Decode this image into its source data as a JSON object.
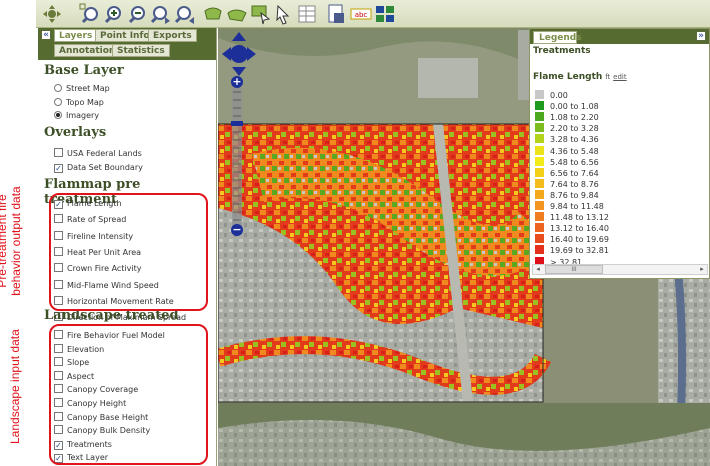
{
  "toolbar": {
    "buttons": [
      {
        "name": "pan-icon"
      },
      {
        "name": "zoom-extent-icon"
      },
      {
        "name": "zoom-in-icon"
      },
      {
        "name": "zoom-out-icon"
      },
      {
        "name": "zoom-previous-icon"
      },
      {
        "name": "zoom-next-icon"
      },
      {
        "name": "draw-polygon-icon"
      },
      {
        "name": "draw-area-icon"
      },
      {
        "name": "draw-select-icon"
      },
      {
        "name": "identify-icon"
      },
      {
        "name": "table-icon"
      },
      {
        "name": "export-icon"
      },
      {
        "name": "label-icon"
      },
      {
        "name": "layers-icon"
      }
    ],
    "label_icon_text": "abc"
  },
  "annotations": {
    "pre_treatment": [
      "Pre-treatment fire",
      "behavior output data"
    ],
    "landscape_input": "Landscape input data"
  },
  "left_panel": {
    "collapse_glyph": "«",
    "tabs": [
      "Layers",
      "Point Info",
      "Exports",
      "Annotation",
      "Statistics"
    ],
    "base_layer": {
      "title": "Base Layer",
      "options": [
        {
          "label": "Street Map",
          "selected": false
        },
        {
          "label": "Topo Map",
          "selected": false
        },
        {
          "label": "Imagery",
          "selected": true
        }
      ]
    },
    "overlays": {
      "title": "Overlays",
      "items": [
        {
          "label": "USA Federal Lands",
          "checked": false
        },
        {
          "label": "Data Set Boundary",
          "checked": true
        }
      ]
    },
    "flammap": {
      "title": "Flammap pre treatment",
      "items": [
        {
          "label": "Flame Length",
          "checked": true
        },
        {
          "label": "Rate of Spread",
          "checked": false
        },
        {
          "label": "Fireline Intensity",
          "checked": false
        },
        {
          "label": "Heat Per Unit Area",
          "checked": false
        },
        {
          "label": "Crown Fire Activity",
          "checked": false
        },
        {
          "label": "Mid-Flame Wind Speed",
          "checked": false
        },
        {
          "label": "Horizontal Movement Rate",
          "checked": false
        },
        {
          "label": "Direction of Maximum Spread",
          "checked": false
        }
      ]
    },
    "landscape": {
      "title": "Landscape treated",
      "items": [
        {
          "label": "Fire Behavior Fuel Model",
          "checked": false
        },
        {
          "label": "Elevation",
          "checked": false
        },
        {
          "label": "Slope",
          "checked": false
        },
        {
          "label": "Aspect",
          "checked": false
        },
        {
          "label": "Canopy Coverage",
          "checked": false
        },
        {
          "label": "Canopy Height",
          "checked": false
        },
        {
          "label": "Canopy Base Height",
          "checked": false
        },
        {
          "label": "Canopy Bulk Density",
          "checked": false
        },
        {
          "label": "Treatments",
          "checked": true
        },
        {
          "label": "Text Layer",
          "checked": true
        }
      ]
    }
  },
  "map": {
    "zoom_in": "+",
    "zoom_out": "−"
  },
  "legend": {
    "tab": "Legends",
    "expand_glyph": "»",
    "section": "Treatments",
    "title": "Flame Length",
    "unit": "ft",
    "edit": "edit",
    "scroll_thumb": "III",
    "classes": [
      {
        "label": "0.00",
        "color": "#c8c8c8"
      },
      {
        "label": "0.00 to 1.08",
        "color": "#1e9a1e"
      },
      {
        "label": "1.08 to 2.20",
        "color": "#4ca81f"
      },
      {
        "label": "2.20 to 3.28",
        "color": "#7cbc1f"
      },
      {
        "label": "3.28 to 4.36",
        "color": "#b4d41c"
      },
      {
        "label": "4.36 to 5.48",
        "color": "#ece41a"
      },
      {
        "label": "5.48 to 6.56",
        "color": "#f4ec18"
      },
      {
        "label": "6.56 to 7.64",
        "color": "#f4d018"
      },
      {
        "label": "7.64 to 8.76",
        "color": "#f4bc1c"
      },
      {
        "label": "8.76 to 9.84",
        "color": "#f4a81e"
      },
      {
        "label": "9.84 to 11.48",
        "color": "#f49420"
      },
      {
        "label": "11.48 to 13.12",
        "color": "#f07c20"
      },
      {
        "label": "13.12 to 16.40",
        "color": "#ec6420"
      },
      {
        "label": "16.40 to 19.69",
        "color": "#e84c1e"
      },
      {
        "label": "19.69 to 32.81",
        "color": "#e4301c"
      },
      {
        "label": "> 32.81",
        "color": "#e0101a"
      }
    ]
  }
}
